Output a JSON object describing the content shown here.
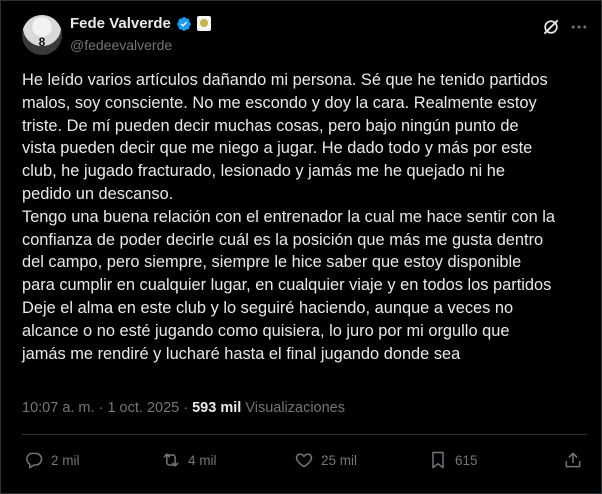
{
  "author": {
    "name": "Fede Valverde",
    "handle": "@fedeevalverde",
    "avatar_number": "8",
    "verified_icon": "verified-badge-icon",
    "affiliate_icon": "club-badge-icon"
  },
  "header_icons": [
    "grok-icon",
    "more-icon"
  ],
  "tweet": {
    "lines": [
      "He leído varios artículos dañando mi persona. Sé que he tenido partidos",
      "malos, soy consciente. No me escondo y doy la cara. Realmente estoy",
      "triste. De mí pueden decir muchas cosas, pero bajo ningún punto de",
      "vista pueden decir que me niego a jugar. He dado todo y más por este",
      "club, he jugado fracturado, lesionado y jamás me he quejado ni he",
      "pedido un descanso.",
      "Tengo una buena relación con el entrenador la cual me hace sentir con la",
      "confianza de poder decirle cuál es la posición que más me gusta dentro",
      "del campo, pero siempre, siempre le hice saber que estoy disponible",
      "para cumplir en cualquier lugar, en cualquier viaje y en todos los partidos",
      "Deje el alma en este club y lo seguiré haciendo, aunque a veces no",
      "alcance o no esté jugando como quisiera, lo juro por mi orgullo que",
      "jamás me rendiré y lucharé hasta el final jugando donde sea"
    ]
  },
  "meta": {
    "time": "10:07 a. m.",
    "separator": "·",
    "date": "1 oct. 2025",
    "views_count": "593 mil",
    "views_label": "Visualizaciones"
  },
  "actions": {
    "reply": "2 mil",
    "retweet": "4 mil",
    "like": "25 mil",
    "bookmark": "615"
  },
  "colors": {
    "background": "#000000",
    "text": "#e7e9ea",
    "secondary": "#71767b",
    "verified": "#1d9bf0",
    "divider": "#2f3336"
  }
}
